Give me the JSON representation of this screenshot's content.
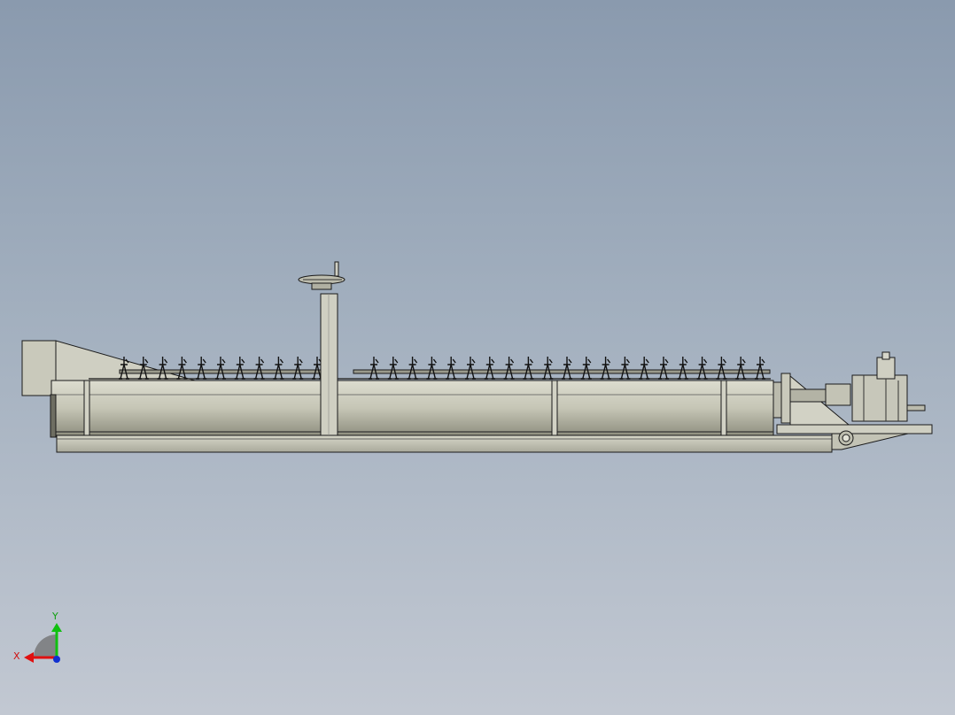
{
  "viewport": {
    "background_top": "#8a9aae",
    "background_bottom": "#c2c8d2",
    "model_fill": "#c9c9bb",
    "model_shade": "#a9a99b",
    "edge_color": "#1a1a1a"
  },
  "triad": {
    "x_label": "X",
    "y_label": "Y",
    "x_color": "#e01010",
    "y_color": "#10c010",
    "z_color": "#1030d0"
  },
  "model": {
    "agitator_arm_count_left": 11,
    "agitator_arm_count_right": 21
  }
}
